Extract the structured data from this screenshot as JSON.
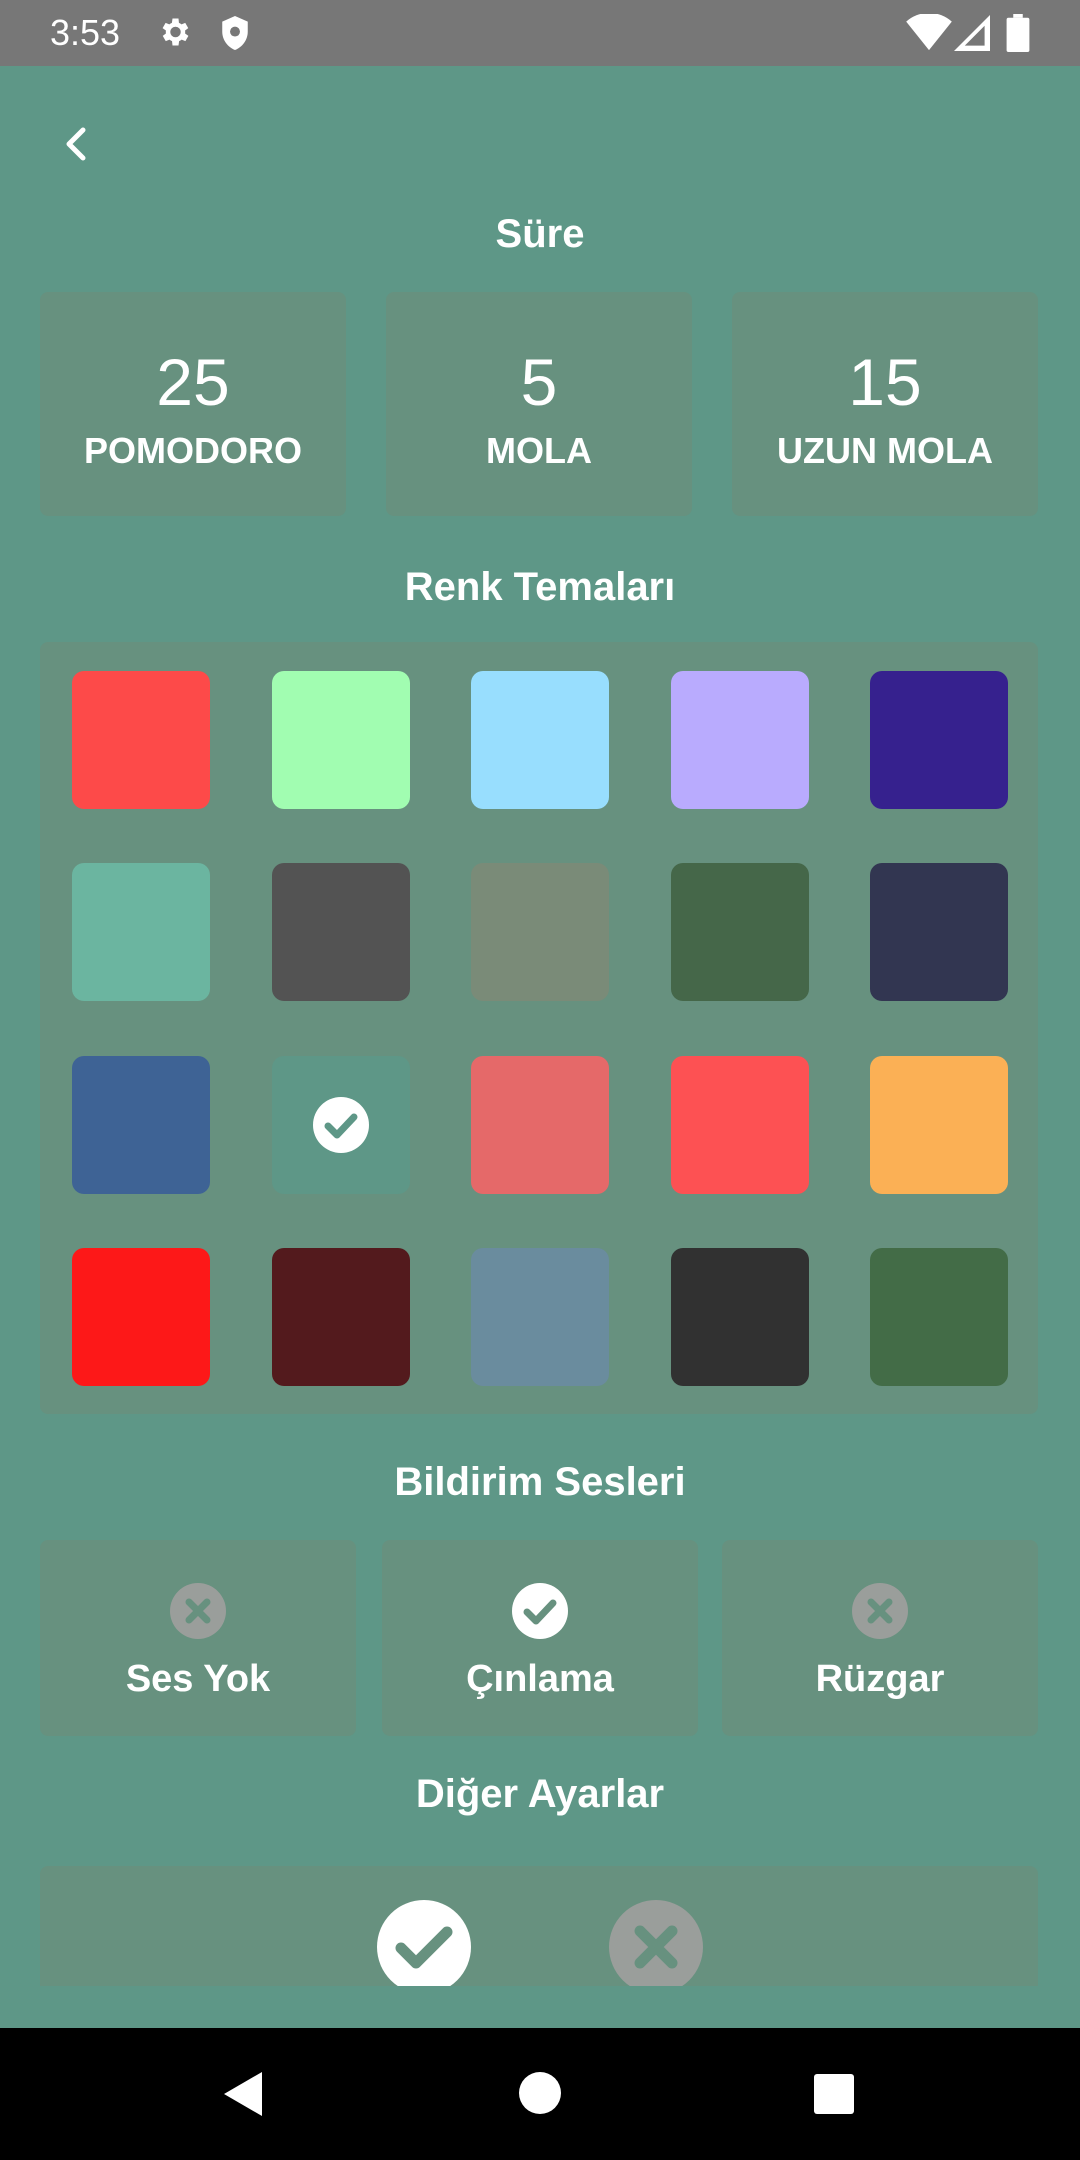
{
  "status": {
    "time": "3:53"
  },
  "sections": {
    "duration": "Süre",
    "themes": "Renk Temaları",
    "sounds": "Bildirim Sesleri",
    "other": "Diğer Ayarlar"
  },
  "durations": [
    {
      "value": "25",
      "label": "POMODORO"
    },
    {
      "value": "5",
      "label": "MOLA"
    },
    {
      "value": "15",
      "label": "UZUN MOLA"
    }
  ],
  "themes": [
    {
      "color": "#fd4a49",
      "selected": false
    },
    {
      "color": "#a1fdb1",
      "selected": false
    },
    {
      "color": "#98defe",
      "selected": false
    },
    {
      "color": "#b9abfe",
      "selected": false
    },
    {
      "color": "#36218e",
      "selected": false
    },
    {
      "color": "#6bb5a0",
      "selected": false
    },
    {
      "color": "#535353",
      "selected": false
    },
    {
      "color": "#7a8b78",
      "selected": false
    },
    {
      "color": "#456749",
      "selected": false
    },
    {
      "color": "#323651",
      "selected": false
    },
    {
      "color": "#3e6395",
      "selected": false
    },
    {
      "color": "#5e9787",
      "selected": true
    },
    {
      "color": "#e56969",
      "selected": false
    },
    {
      "color": "#fd5153",
      "selected": false
    },
    {
      "color": "#fbb055",
      "selected": false
    },
    {
      "color": "#fd1818",
      "selected": false
    },
    {
      "color": "#531a1d",
      "selected": false
    },
    {
      "color": "#6a8c9e",
      "selected": false
    },
    {
      "color": "#313131",
      "selected": false
    },
    {
      "color": "#436c47",
      "selected": false
    }
  ],
  "sounds": [
    {
      "label": "Ses Yok",
      "selected": false
    },
    {
      "label": "Çınlama",
      "selected": true
    },
    {
      "label": "Rüzgar",
      "selected": false
    }
  ],
  "other": {
    "option_on": true,
    "option_off": false
  }
}
